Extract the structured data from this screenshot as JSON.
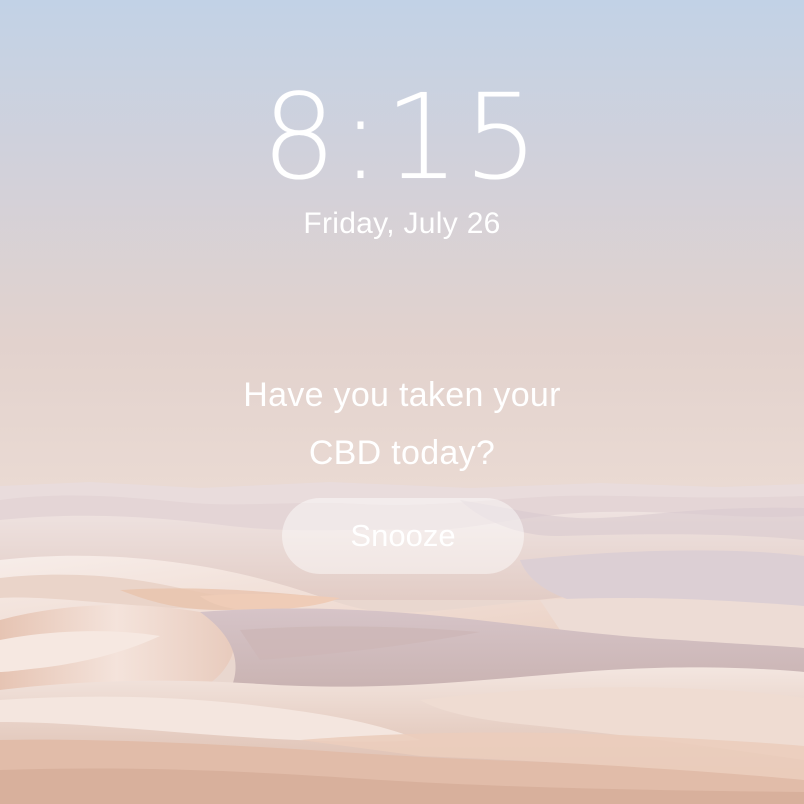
{
  "lock_screen": {
    "time": "8:15",
    "date": "Friday, July 26"
  },
  "alarm": {
    "message_line1": "Have you taken your",
    "message_line2": "CBD today?",
    "snooze_label": "Snooze"
  },
  "colors": {
    "sky_top": "#c3d3e6",
    "horizon": "#e9d7cf",
    "sand_light": "#f6ece8",
    "sand_warm": "#e6c3b3",
    "text": "#ffffff"
  }
}
